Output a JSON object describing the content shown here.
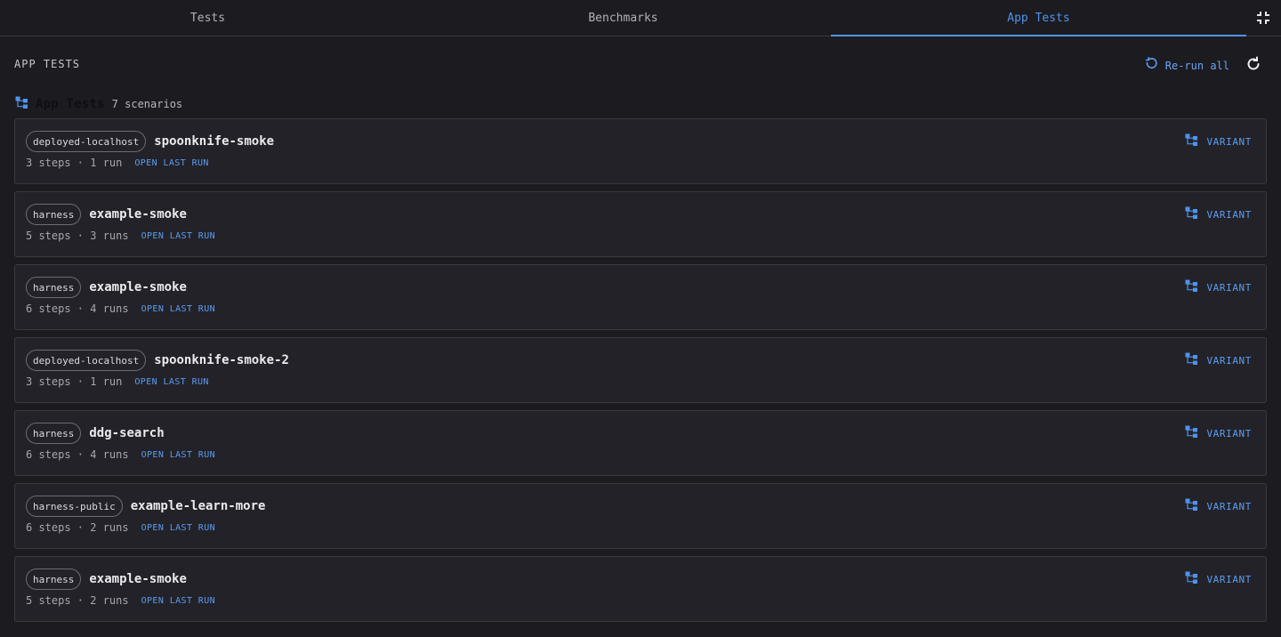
{
  "tabs": [
    {
      "label": "Tests",
      "active": false
    },
    {
      "label": "Benchmarks",
      "active": false
    },
    {
      "label": "App Tests",
      "active": true
    }
  ],
  "icons": {
    "collapse": "collapse-icon",
    "rerun": "rerun-icon",
    "refresh": "refresh-icon",
    "group": "tree-icon",
    "variant": "tree-icon"
  },
  "colors": {
    "accent": "#4f93ee",
    "background": "#1c1b20",
    "card": "#232228"
  },
  "section": {
    "title": "APP TESTS",
    "rerun_label": "Re-run all"
  },
  "group": {
    "name": "App Tests",
    "count": "7 scenarios"
  },
  "scenarios": [
    {
      "env": "deployed-localhost",
      "name": "spoonknife-smoke",
      "meta": "3 steps · 1 run",
      "open_label": "OPEN LAST RUN",
      "variant_label": "VARIANT"
    },
    {
      "env": "harness",
      "name": "example-smoke",
      "meta": "5 steps · 3 runs",
      "open_label": "OPEN LAST RUN",
      "variant_label": "VARIANT"
    },
    {
      "env": "harness",
      "name": "example-smoke",
      "meta": "6 steps · 4 runs",
      "open_label": "OPEN LAST RUN",
      "variant_label": "VARIANT"
    },
    {
      "env": "deployed-localhost",
      "name": "spoonknife-smoke-2",
      "meta": "3 steps · 1 run",
      "open_label": "OPEN LAST RUN",
      "variant_label": "VARIANT"
    },
    {
      "env": "harness",
      "name": "ddg-search",
      "meta": "6 steps · 4 runs",
      "open_label": "OPEN LAST RUN",
      "variant_label": "VARIANT"
    },
    {
      "env": "harness-public",
      "name": "example-learn-more",
      "meta": "6 steps · 2 runs",
      "open_label": "OPEN LAST RUN",
      "variant_label": "VARIANT"
    },
    {
      "env": "harness",
      "name": "example-smoke",
      "meta": "5 steps · 2 runs",
      "open_label": "OPEN LAST RUN",
      "variant_label": "VARIANT"
    }
  ]
}
